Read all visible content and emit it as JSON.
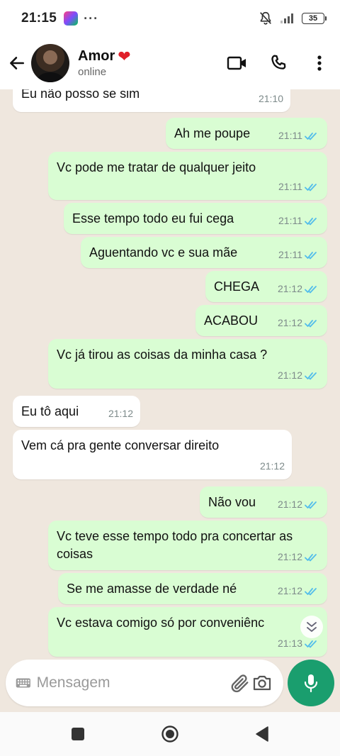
{
  "status_bar": {
    "time": "21:15",
    "dots": "···",
    "battery": "35"
  },
  "header": {
    "contact_name": "Amor",
    "status": "online"
  },
  "messages": [
    {
      "dir": "in",
      "text": "Eu não posso se                 sim",
      "time": "21:10",
      "partial": true
    },
    {
      "dir": "out",
      "text": "Ah me poupe",
      "time": "21:11"
    },
    {
      "dir": "out",
      "text": "Vc pode me tratar de qualquer jeito",
      "time": "21:11"
    },
    {
      "dir": "out",
      "text": "Esse tempo todo eu fui cega",
      "time": "21:11"
    },
    {
      "dir": "out",
      "text": "Aguentando vc e sua mãe",
      "time": "21:11"
    },
    {
      "dir": "out",
      "text": "CHEGA",
      "time": "21:12"
    },
    {
      "dir": "out",
      "text": "ACABOU",
      "time": "21:12"
    },
    {
      "dir": "out",
      "text": "Vc já tirou as coisas da minha casa ?",
      "time": "21:12"
    },
    {
      "dir": "in",
      "text": "Eu tô aqui",
      "time": "21:12"
    },
    {
      "dir": "in",
      "text": "Vem cá pra gente conversar direito",
      "time": "21:12"
    },
    {
      "dir": "out",
      "text": "Não vou",
      "time": "21:12"
    },
    {
      "dir": "out",
      "text": "Vc teve esse tempo todo pra concertar as coisas",
      "time": "21:12"
    },
    {
      "dir": "out",
      "text": "Se me amasse de verdade né",
      "time": "21:12"
    },
    {
      "dir": "out",
      "text": "Vc estava comigo só por conveniênc",
      "time": "21:13"
    }
  ],
  "composer": {
    "placeholder": "Mensagem"
  },
  "colors": {
    "accent": "#1a9e6e",
    "read_ticks": "#53bdeb",
    "outgoing_bubble": "#d9fdd3",
    "chat_bg": "#efe7de"
  }
}
